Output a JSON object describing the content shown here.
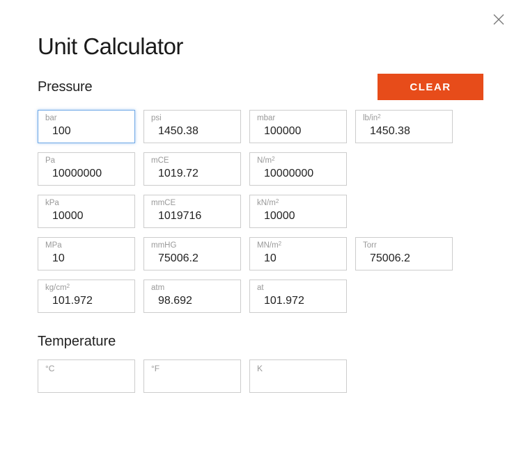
{
  "title": "Unit Calculator",
  "close_icon": "close",
  "clear_label": "CLEAR",
  "pressure": {
    "title": "Pressure",
    "fields": [
      {
        "label": "bar",
        "value": "100",
        "focused": true
      },
      {
        "label": "psi",
        "value": "1450.38"
      },
      {
        "label": "mbar",
        "value": "100000"
      },
      {
        "label_html": "lb/in<sup>2</sup>",
        "value": "1450.38"
      },
      {
        "label": "Pa",
        "value": "10000000"
      },
      {
        "label": "mCE",
        "value": "1019.72"
      },
      {
        "label_html": "N/m<sup>2</sup>",
        "value": "10000000"
      },
      null,
      {
        "label": "kPa",
        "value": "10000"
      },
      {
        "label": "mmCE",
        "value": "1019716"
      },
      {
        "label_html": "kN/m<sup>2</sup>",
        "value": "10000"
      },
      null,
      {
        "label": "MPa",
        "value": "10"
      },
      {
        "label": "mmHG",
        "value": "75006.2"
      },
      {
        "label_html": "MN/m<sup>2</sup>",
        "value": "10"
      },
      {
        "label": "Torr",
        "value": "75006.2"
      },
      {
        "label_html": "kg/cm<sup>2</sup>",
        "value": "101.972"
      },
      {
        "label": "atm",
        "value": "98.692"
      },
      {
        "label": "at",
        "value": "101.972"
      }
    ]
  },
  "temperature": {
    "title": "Temperature",
    "fields": [
      {
        "label": "°C",
        "value": ""
      },
      {
        "label": "°F",
        "value": ""
      },
      {
        "label": "K",
        "value": ""
      }
    ]
  }
}
